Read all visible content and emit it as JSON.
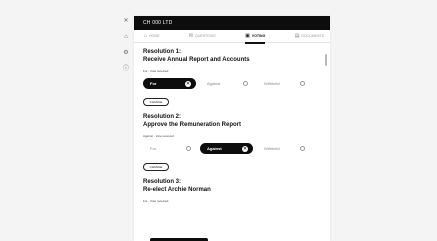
{
  "rail": {
    "icons": [
      "close-icon",
      "home-icon",
      "settings-icon",
      "info-icon"
    ]
  },
  "header": {
    "title": "CH 000 LTD"
  },
  "tabs": [
    {
      "label": "HOME",
      "icon": "home-icon",
      "active": false
    },
    {
      "label": "QUESTIONS",
      "icon": "chat-icon",
      "active": false
    },
    {
      "label": "VOTING",
      "icon": "ballot-icon",
      "active": true
    },
    {
      "label": "DOCUMENTS",
      "icon": "document-icon",
      "active": false
    }
  ],
  "resolutions": [
    {
      "number": "Resolution 1:",
      "title": "Receive Annual Report and Accounts",
      "vote_label": "For - Vote received",
      "options": [
        {
          "label": "For",
          "selected": true
        },
        {
          "label": "Against",
          "selected": false
        },
        {
          "label": "Withheld",
          "selected": false
        }
      ],
      "more_label": "CHANGE"
    },
    {
      "number": "Resolution 2:",
      "title": "Approve the Remuneration Report",
      "vote_label": "Against - Vote received",
      "options": [
        {
          "label": "For",
          "selected": false
        },
        {
          "label": "Against",
          "selected": true
        },
        {
          "label": "Withheld",
          "selected": false
        }
      ],
      "more_label": "CHANGE"
    },
    {
      "number": "Resolution 3:",
      "title": "Re-elect Archie Norman",
      "vote_label": "For - Vote received",
      "options": [],
      "more_label": ""
    }
  ]
}
